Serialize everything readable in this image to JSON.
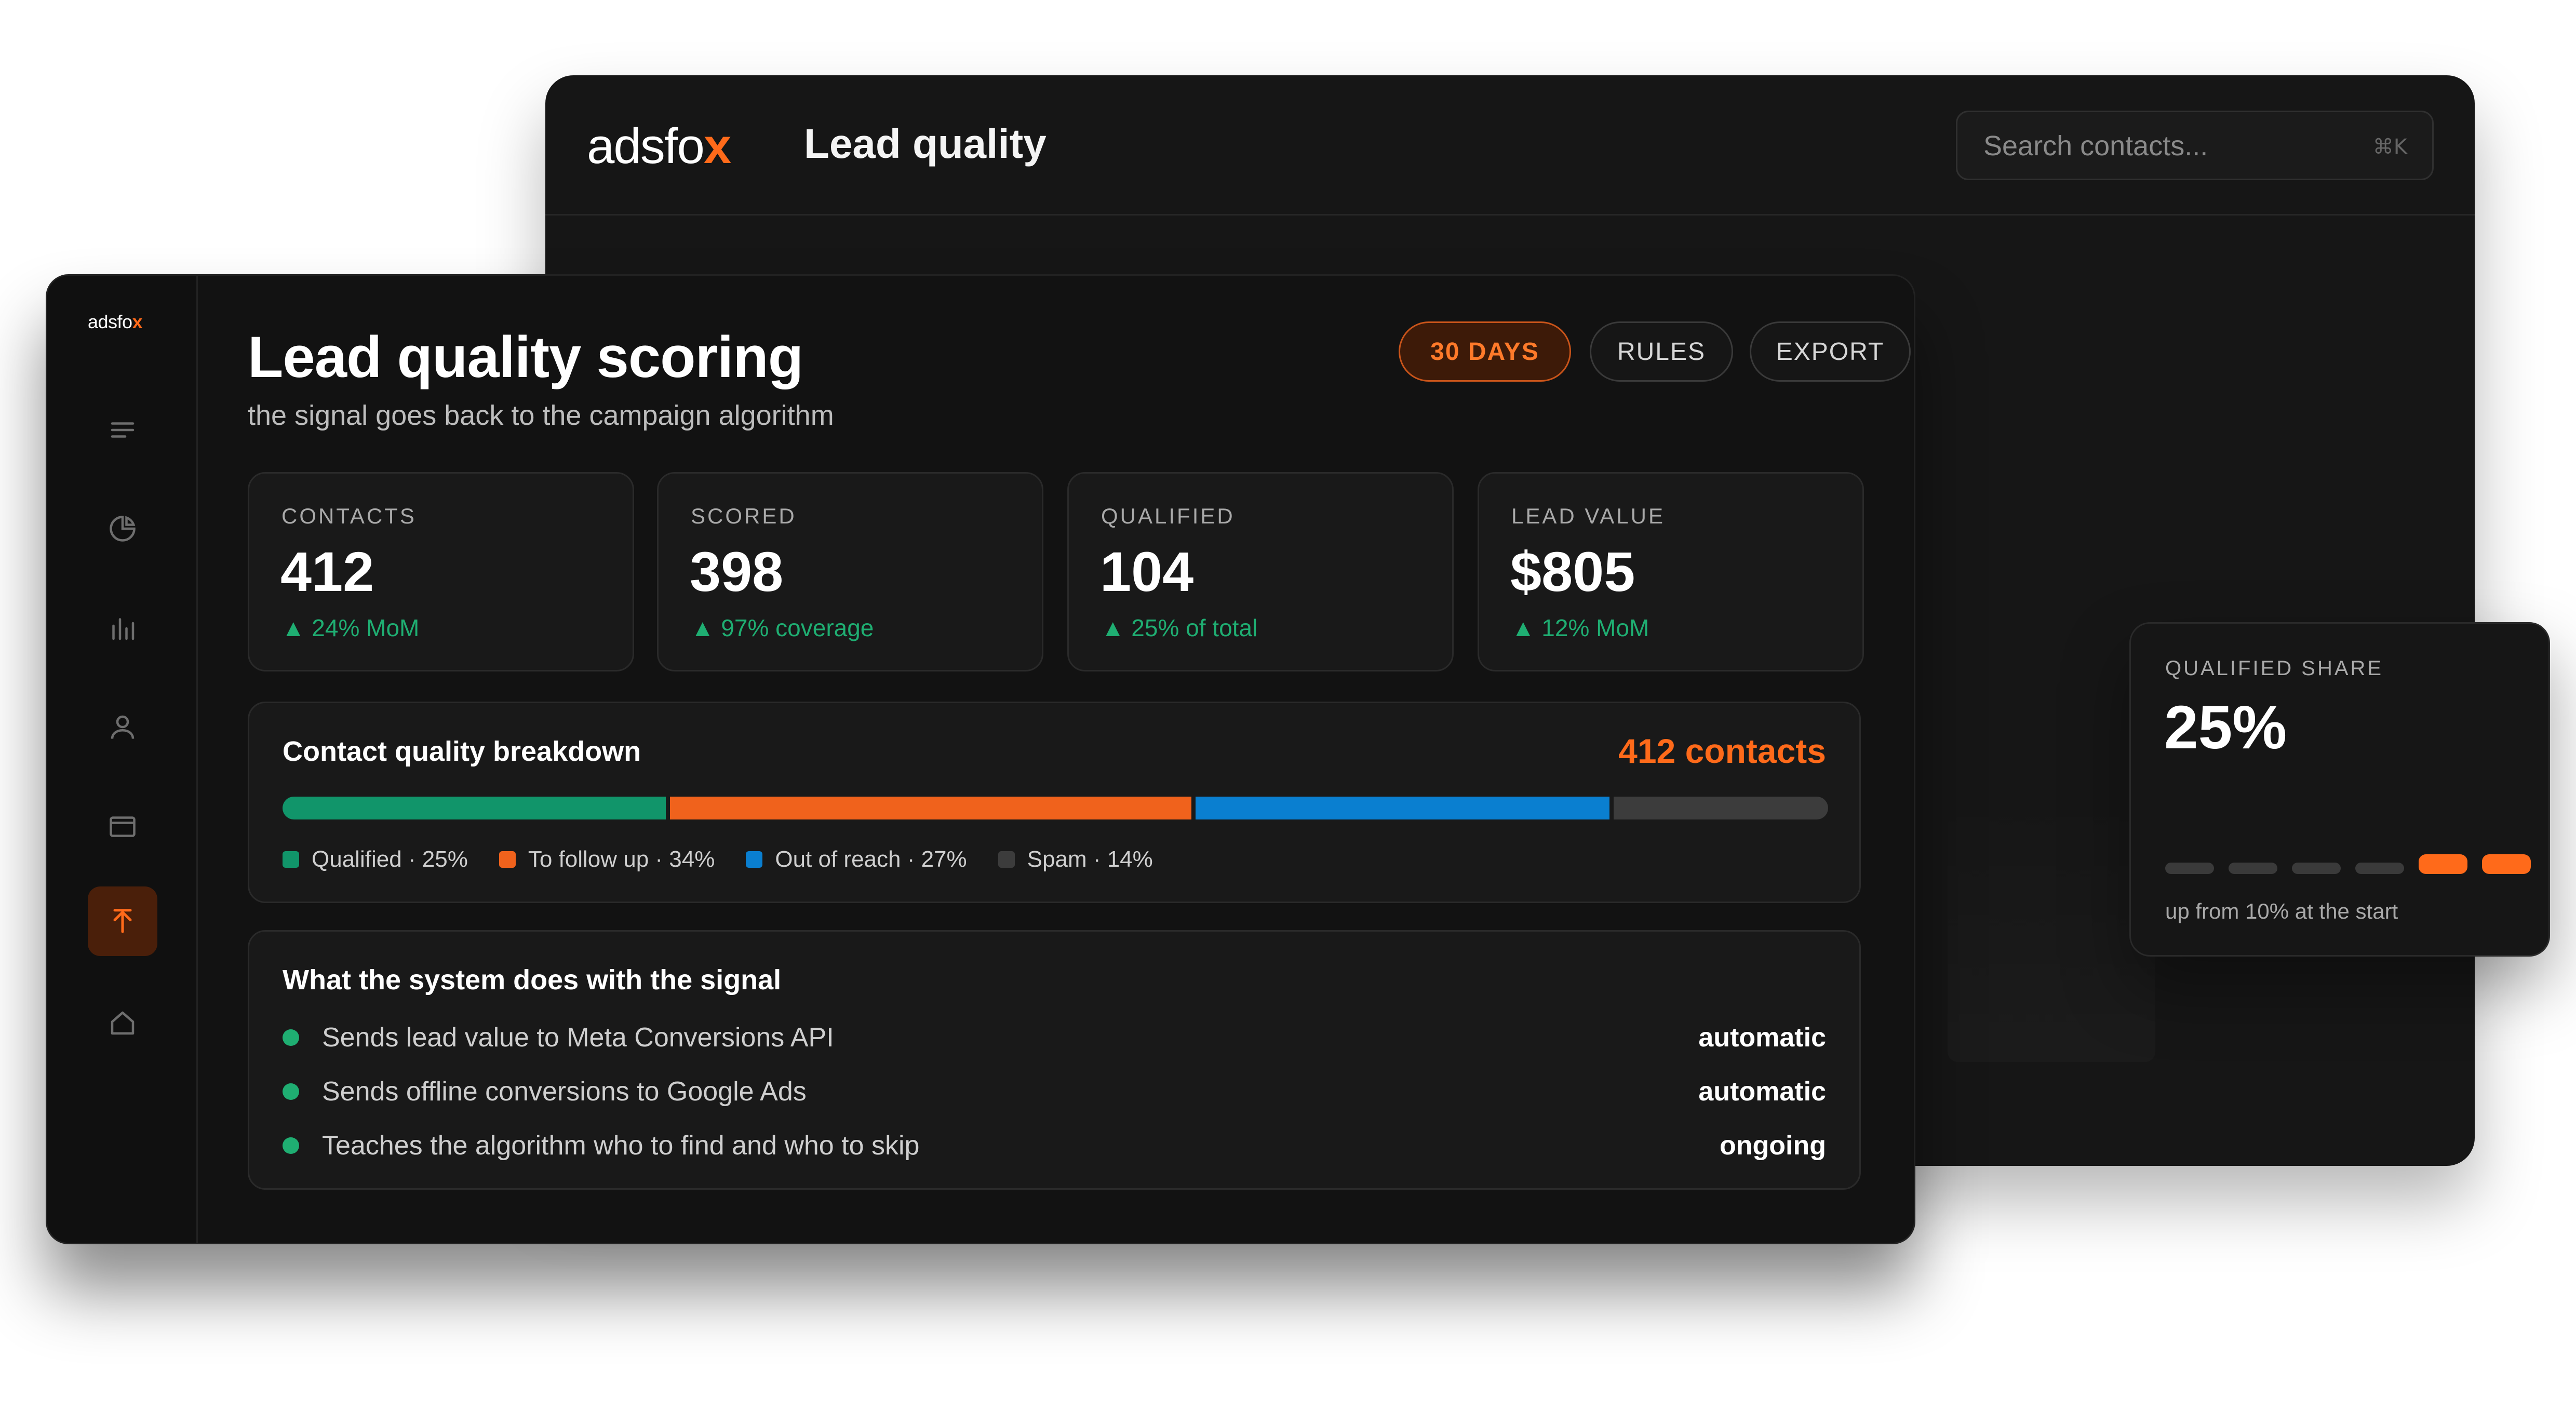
{
  "back_window": {
    "logo_text": "adsfo",
    "logo_accent": "x",
    "title": "Lead quality",
    "search": {
      "placeholder": "Search contacts...",
      "shortcut": "⌘K"
    }
  },
  "sidebar": {
    "logo_text": "adsfo",
    "logo_accent": "x",
    "items": [
      {
        "icon": "menu-icon"
      },
      {
        "icon": "pie-chart-icon"
      },
      {
        "icon": "bar-chart-icon"
      },
      {
        "icon": "user-icon"
      },
      {
        "icon": "card-icon"
      },
      {
        "icon": "upload-arrow-icon",
        "active": true
      },
      {
        "icon": "home-icon"
      }
    ]
  },
  "header": {
    "title": "Lead quality scoring",
    "subtitle": "the signal goes back to the campaign algorithm"
  },
  "filters": {
    "days_label": "30 DAYS",
    "rules_label": "RULES",
    "export_label": "EXPORT"
  },
  "kpis": [
    {
      "label": "CONTACTS",
      "value": "412",
      "delta": "▲ 24% MoM"
    },
    {
      "label": "SCORED",
      "value": "398",
      "delta": "▲ 97% coverage"
    },
    {
      "label": "QUALIFIED",
      "value": "104",
      "delta": "▲ 25% of total"
    },
    {
      "label": "LEAD VALUE",
      "value": "$805",
      "delta": "▲ 12% MoM"
    }
  ],
  "breakdown": {
    "title": "Contact quality breakdown",
    "count": "412 contacts",
    "segments": [
      {
        "legend": "Qualified · 25%",
        "share": 25,
        "color": "#11956a"
      },
      {
        "legend": "To follow up · 34%",
        "share": 34,
        "color": "#f0621c"
      },
      {
        "legend": "Out of reach · 27%",
        "share": 27,
        "color": "#0a7fd0"
      },
      {
        "legend": "Spam · 14%",
        "share": 14,
        "color": "#3c3c3c"
      }
    ]
  },
  "actions": {
    "title": "What the system does with the signal",
    "rows": [
      {
        "text": "Sends lead value to Meta Conversions API",
        "status": "automatic"
      },
      {
        "text": "Sends offline conversions to Google Ads",
        "status": "automatic"
      },
      {
        "text": "Teaches the algorithm who to find and who to skip",
        "status": "ongoing"
      }
    ]
  },
  "share_card": {
    "label": "QUALIFIED SHARE",
    "value": "25%",
    "note": "up from 10% at the start",
    "steps": [
      {
        "highlight": false
      },
      {
        "highlight": false
      },
      {
        "highlight": false
      },
      {
        "highlight": false
      },
      {
        "highlight": true
      },
      {
        "highlight": true
      }
    ]
  },
  "colors": {
    "accent": "#ff6a1a",
    "positive": "#1fae72",
    "background": "#121212"
  }
}
